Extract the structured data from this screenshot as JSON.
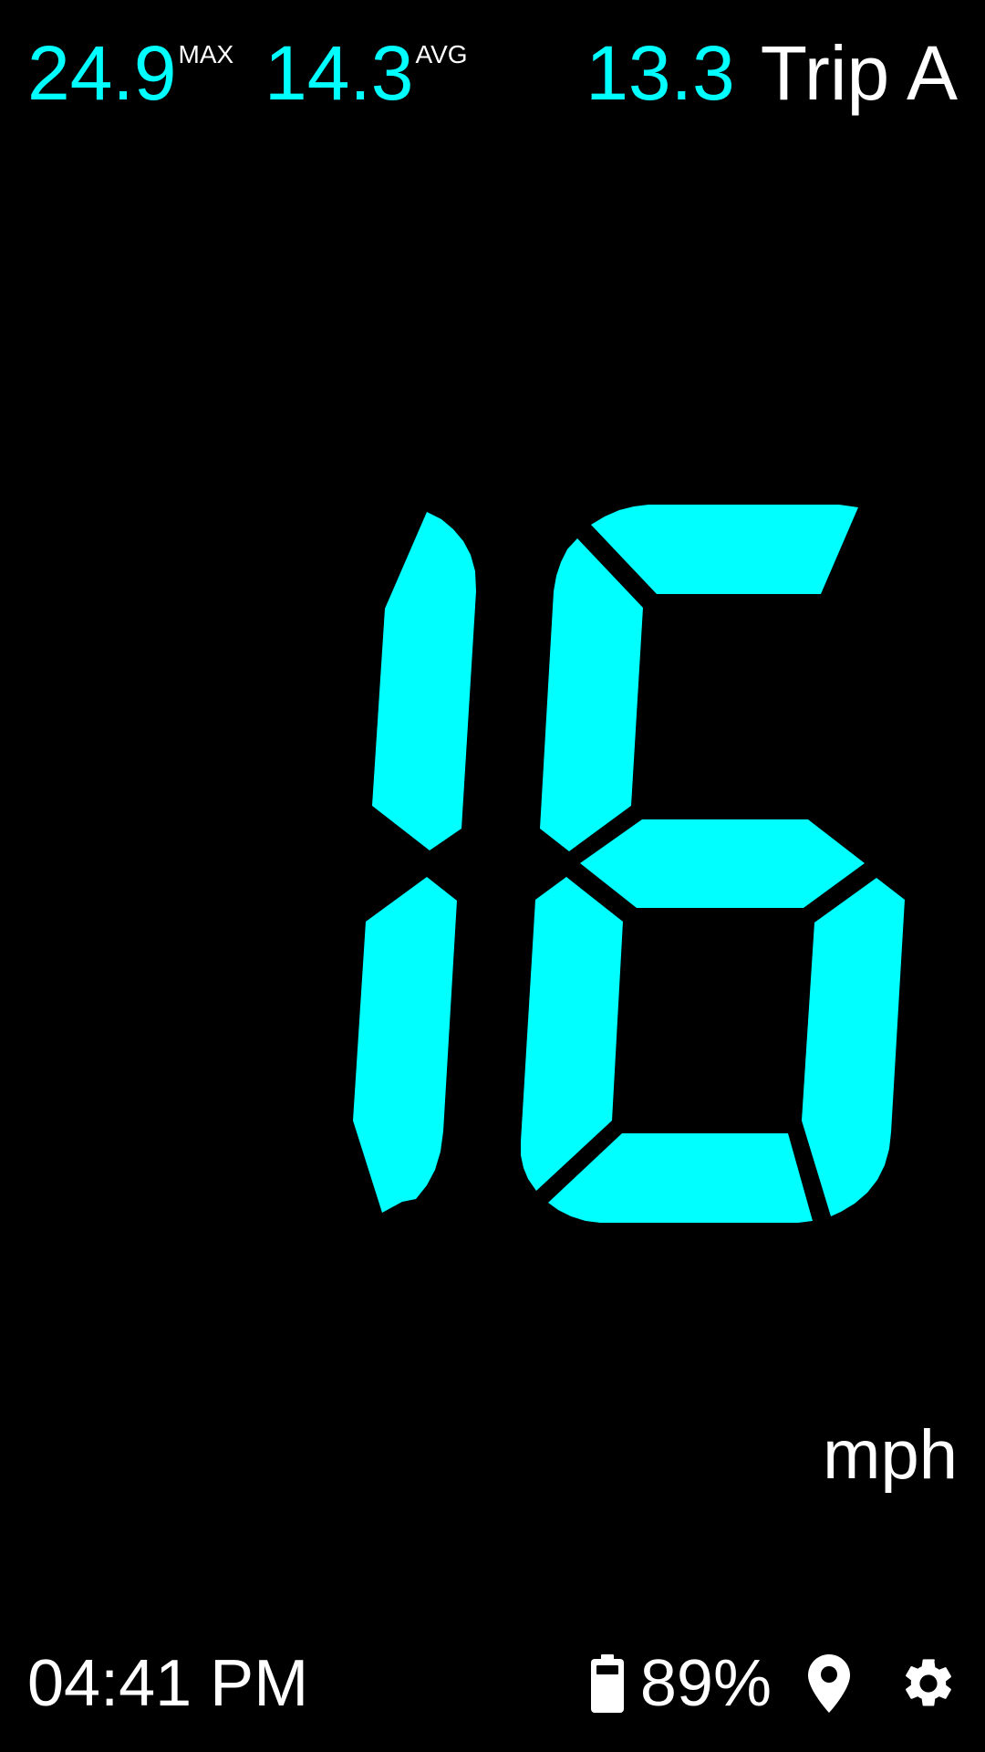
{
  "stats": {
    "max_value": "24.9",
    "max_label": "MAX",
    "avg_value": "14.3",
    "avg_label": "AVG",
    "trip_value": "13.3",
    "trip_label": "Trip A"
  },
  "speed": {
    "value": "16",
    "unit": "mph"
  },
  "status": {
    "time": "04:41 PM",
    "battery": "89%"
  },
  "icons": {
    "battery": "battery-icon",
    "location": "location-pin-icon",
    "settings": "gear-icon"
  },
  "colors": {
    "accent": "#00ffff",
    "text": "#ffffff",
    "background": "#000000"
  }
}
